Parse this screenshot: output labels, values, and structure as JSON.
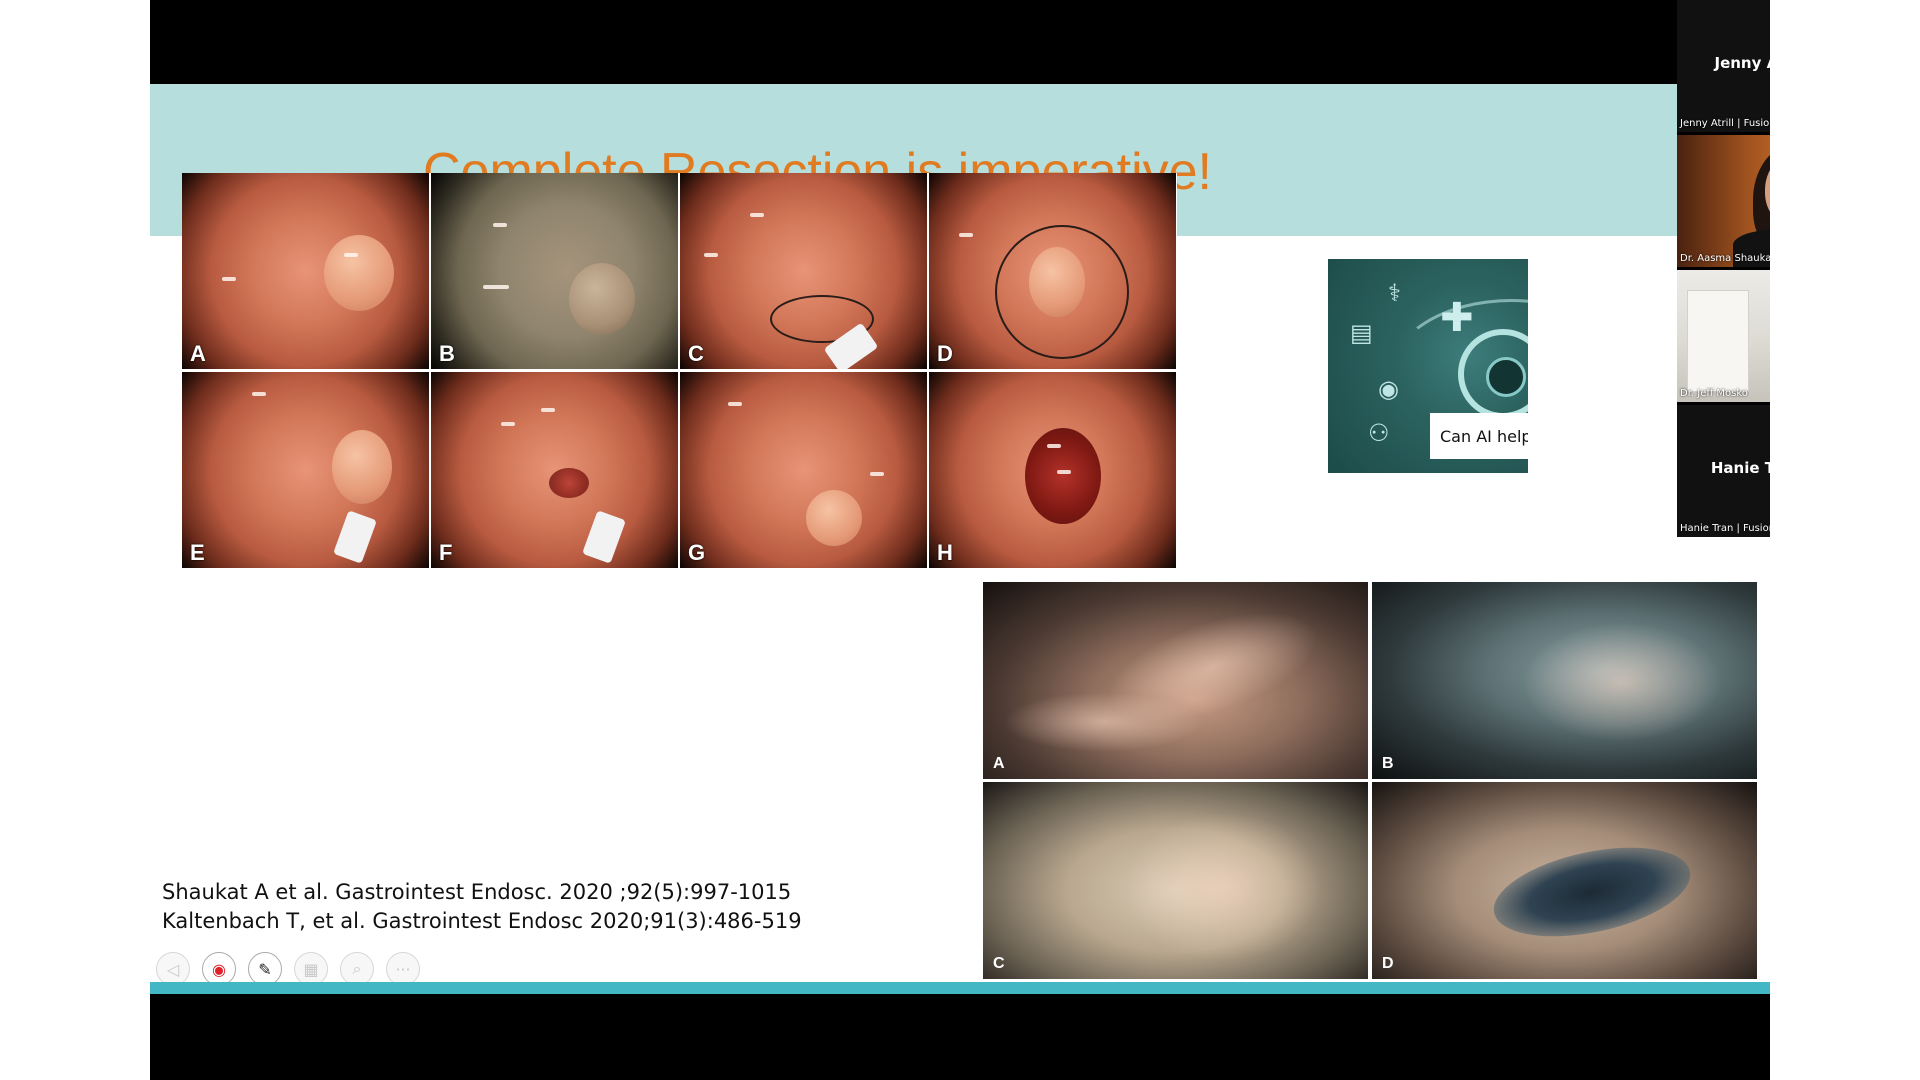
{
  "slide": {
    "title": "Complete Resection is imperative!",
    "panel_a_letters": [
      "A",
      "B",
      "C",
      "D",
      "E",
      "F",
      "G",
      "H"
    ],
    "panel_b_letters": [
      "A",
      "B",
      "C",
      "D"
    ],
    "citations": [
      "Shaukat A et al. Gastrointest Endosc. 2020 ;92(5):997-1015",
      "Kaltenbach T, et al. Gastrointest Endosc 2020;91(3):486-519"
    ],
    "ai_caption": "Can AI help"
  },
  "participants": [
    {
      "display": "Jenny Atrill | Fusi...",
      "label": "Jenny Atrill | Fusion MD",
      "video": false
    },
    {
      "display": "",
      "label": "Dr. Aasma Shaukat",
      "video": true
    },
    {
      "display": "",
      "label": "Dr. Jeff Mosko",
      "video": true
    },
    {
      "display": "Hanie Tran | Fusio...",
      "label": "Hanie Tran | Fusion MD",
      "video": false
    }
  ],
  "toolbar": {
    "buttons": [
      "prev-arrow-icon",
      "laser-pointer-icon",
      "pen-icon",
      "slides-icon",
      "zoom-icon",
      "more-icon"
    ],
    "more_label": "···"
  },
  "colors": {
    "header_band": "#b5dedc",
    "title": "#e07b22",
    "bottom_stripe": "#43b7c3"
  }
}
